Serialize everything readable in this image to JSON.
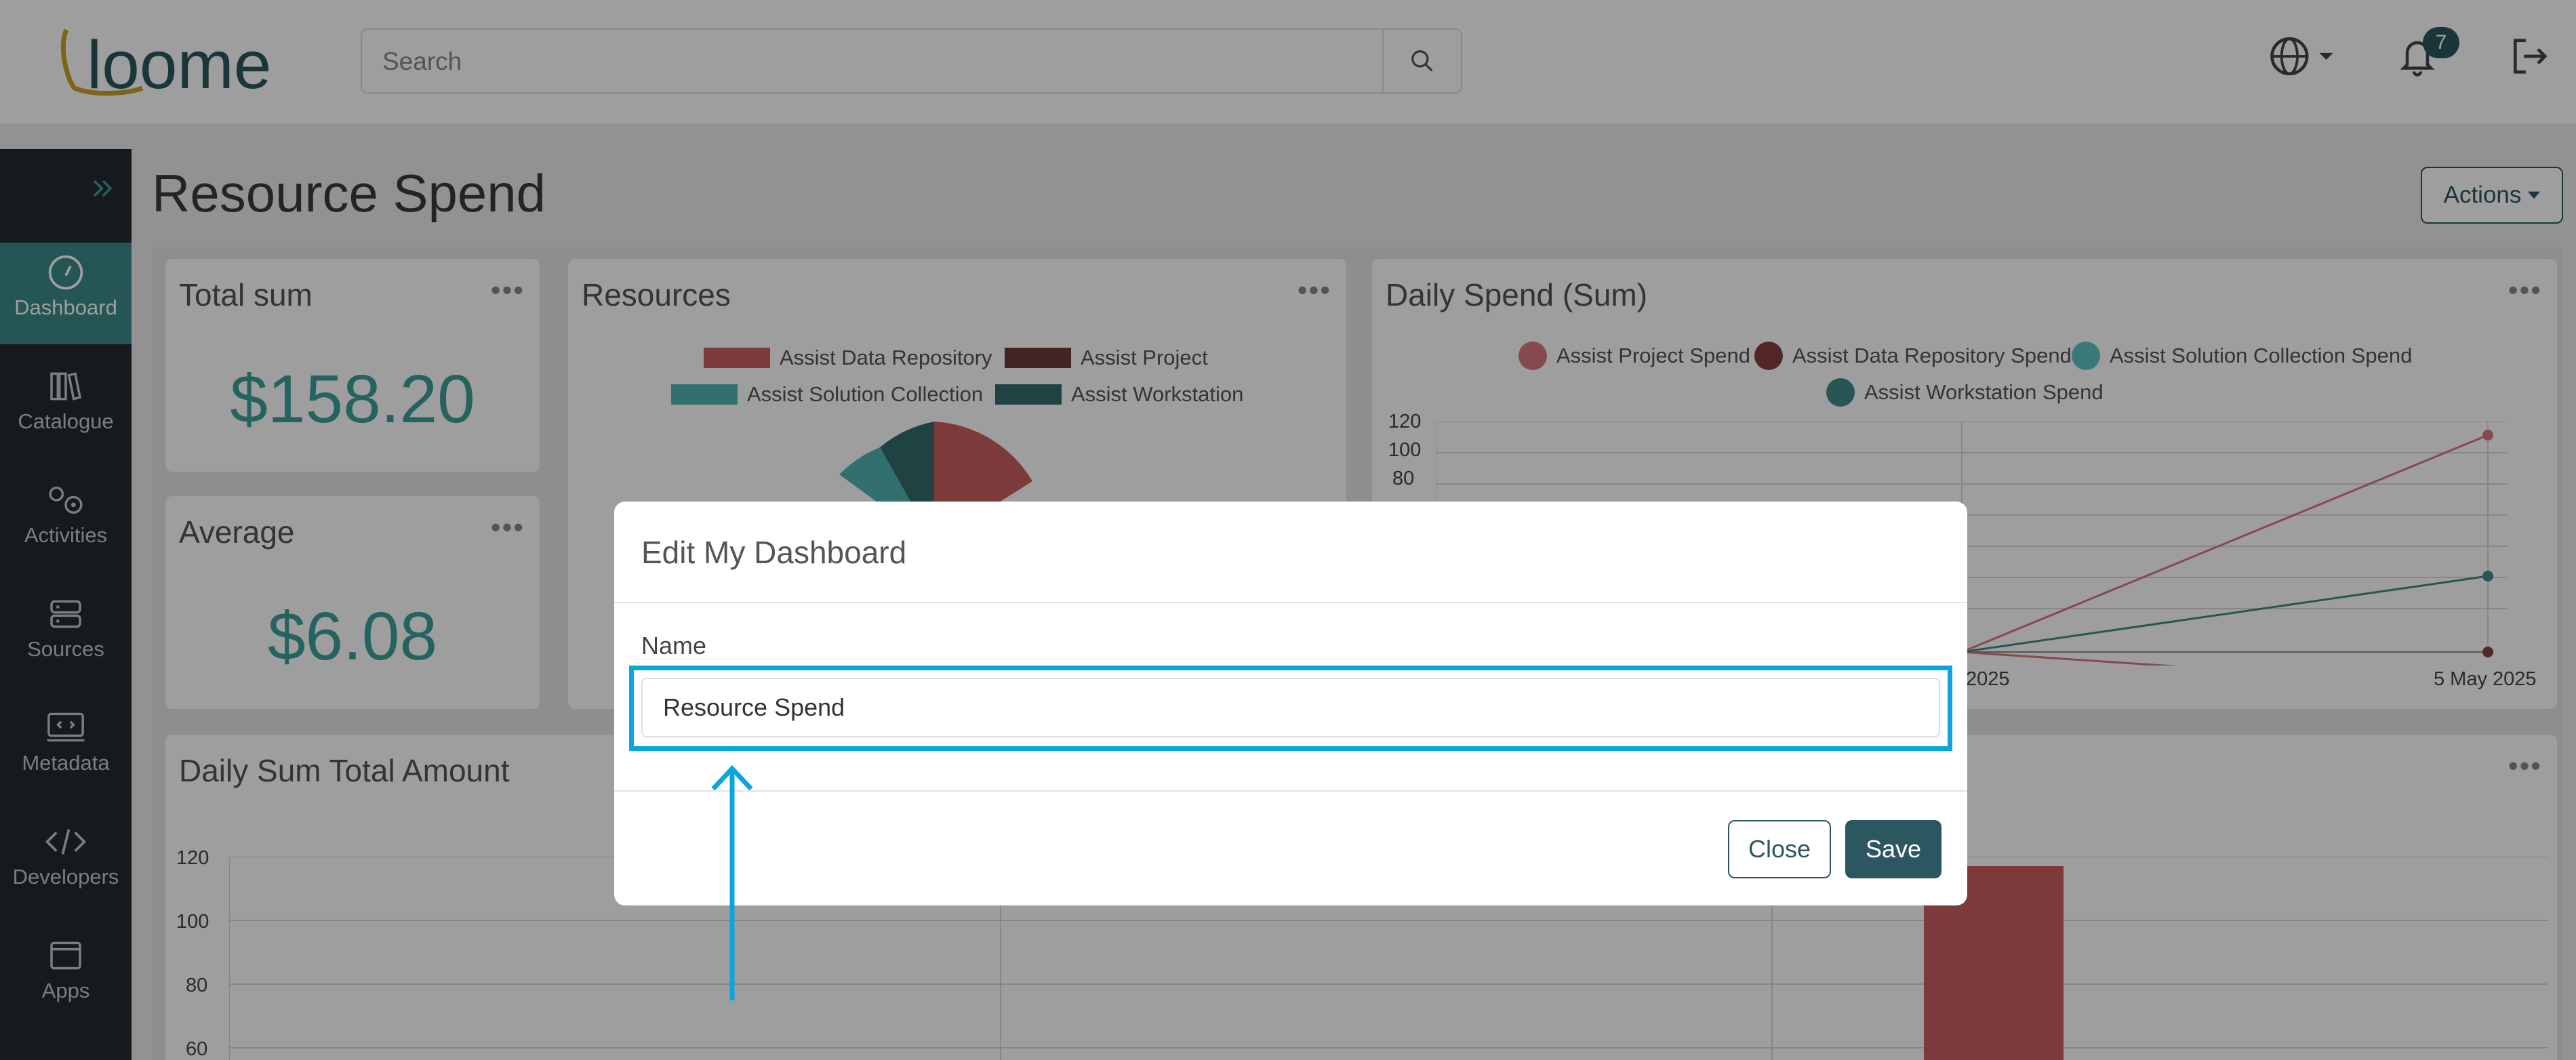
{
  "header": {
    "logo_text": "loome",
    "search_placeholder": "Search",
    "notification_count": "7",
    "icons": [
      "search-icon",
      "globe-icon",
      "bell-icon",
      "logout-icon"
    ]
  },
  "sidebar": {
    "items": [
      {
        "label": "Dashboard",
        "icon": "dashboard-icon",
        "active": true
      },
      {
        "label": "Catalogue",
        "icon": "books-icon"
      },
      {
        "label": "Activities",
        "icon": "gears-icon"
      },
      {
        "label": "Sources",
        "icon": "server-icon"
      },
      {
        "label": "Metadata",
        "icon": "code-screen-icon"
      },
      {
        "label": "Developers",
        "icon": "code-icon"
      },
      {
        "label": "Apps",
        "icon": "window-icon"
      }
    ]
  },
  "page": {
    "title": "Resource Spend",
    "actions_label": "Actions"
  },
  "cards": {
    "total_sum": {
      "title": "Total sum",
      "value": "$158.20"
    },
    "average": {
      "title": "Average",
      "value": "$6.08"
    },
    "resources": {
      "title": "Resources",
      "legend": [
        "Assist Data Repository",
        "Assist Project",
        "Assist Solution Collection",
        "Assist Workstation"
      ]
    },
    "daily_spend": {
      "title": "Daily Spend (Sum)",
      "legend": [
        "Assist Project Spend",
        "Assist Data Repository Spend",
        "Assist Solution Collection Spend",
        "Assist Workstation Spend"
      ],
      "y_ticks": [
        "120",
        "100",
        "80"
      ],
      "x_ticks": [
        "2025",
        "5 May 2025"
      ]
    },
    "daily_sum_total": {
      "title": "Daily Sum Total Amount",
      "y_ticks": [
        "120",
        "100",
        "80",
        "60"
      ]
    }
  },
  "chart_data": [
    {
      "type": "pie",
      "title": "Resources",
      "labels": [
        "Assist Data Repository",
        "Assist Project",
        "Assist Solution Collection",
        "Assist Workstation"
      ],
      "colors": [
        "#c85e5e",
        "#6e3b3b",
        "#52b5b3",
        "#336b6b"
      ]
    },
    {
      "type": "line",
      "title": "Daily Spend (Sum)",
      "x": [
        "2025",
        "5 May 2025"
      ],
      "series": [
        {
          "name": "Assist Project Spend",
          "values": [
            0,
            117
          ],
          "color": "#d9777c"
        },
        {
          "name": "Assist Data Repository Spend",
          "values": [
            0,
            0
          ],
          "color": "#8a3e3e"
        },
        {
          "name": "Assist Solution Collection Spend",
          "values": [
            0,
            0
          ],
          "color": "#5cc4c2"
        },
        {
          "name": "Assist Workstation Spend",
          "values": [
            0,
            40
          ],
          "color": "#3f8c88"
        }
      ],
      "ylim": [
        0,
        120
      ]
    },
    {
      "type": "bar",
      "title": "Daily Sum Total Amount",
      "values": [
        117
      ],
      "color": "#c85e5e",
      "ylim": [
        60,
        120
      ]
    }
  ],
  "modal": {
    "title": "Edit My Dashboard",
    "name_label": "Name",
    "name_value": "Resource Spend",
    "close_label": "Close",
    "save_label": "Save"
  },
  "colors": {
    "brand": "#2c5760",
    "accent": "#3aa199",
    "highlight": "#0aa5de",
    "sidebar": "#242a2f"
  }
}
